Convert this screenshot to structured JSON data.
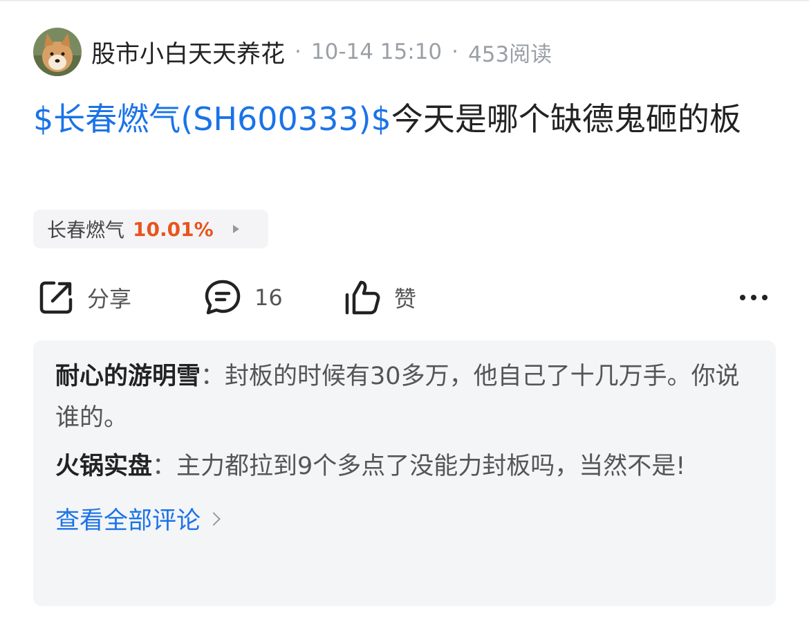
{
  "post": {
    "author": "股市小白天天养花",
    "separator": "·",
    "timestamp": "10-14 15:10",
    "read_count": "453阅读",
    "title_link": "$长春燃气(SH600333)$",
    "title_text": "今天是哪个缺德鬼砸的板"
  },
  "stock_chip": {
    "name": "长春燃气",
    "change": "10.01%",
    "change_color": "#e8541e",
    "arrow_icon": "play-arrow-icon"
  },
  "actions": {
    "share_label": "分享",
    "share_icon": "share-icon",
    "comment_count": "16",
    "comment_icon": "comment-bubble-icon",
    "like_label": "赞",
    "like_icon": "thumbs-up-icon",
    "more_icon": "more-dots-icon"
  },
  "comments": [
    {
      "user": "耐心的游明雪",
      "colon": "：",
      "text": "封板的时候有30多万，他自己了十几万手。你说谁的。"
    },
    {
      "user": "火锅实盘",
      "colon": "：",
      "text": "主力都拉到9个多点了没能力封板吗，当然不是!"
    }
  ],
  "view_all_comments": "查看全部评论",
  "colors": {
    "link": "#1a73e8",
    "text": "#222222",
    "meta": "#9aa0a6",
    "comment_bg": "#f4f5f7"
  }
}
